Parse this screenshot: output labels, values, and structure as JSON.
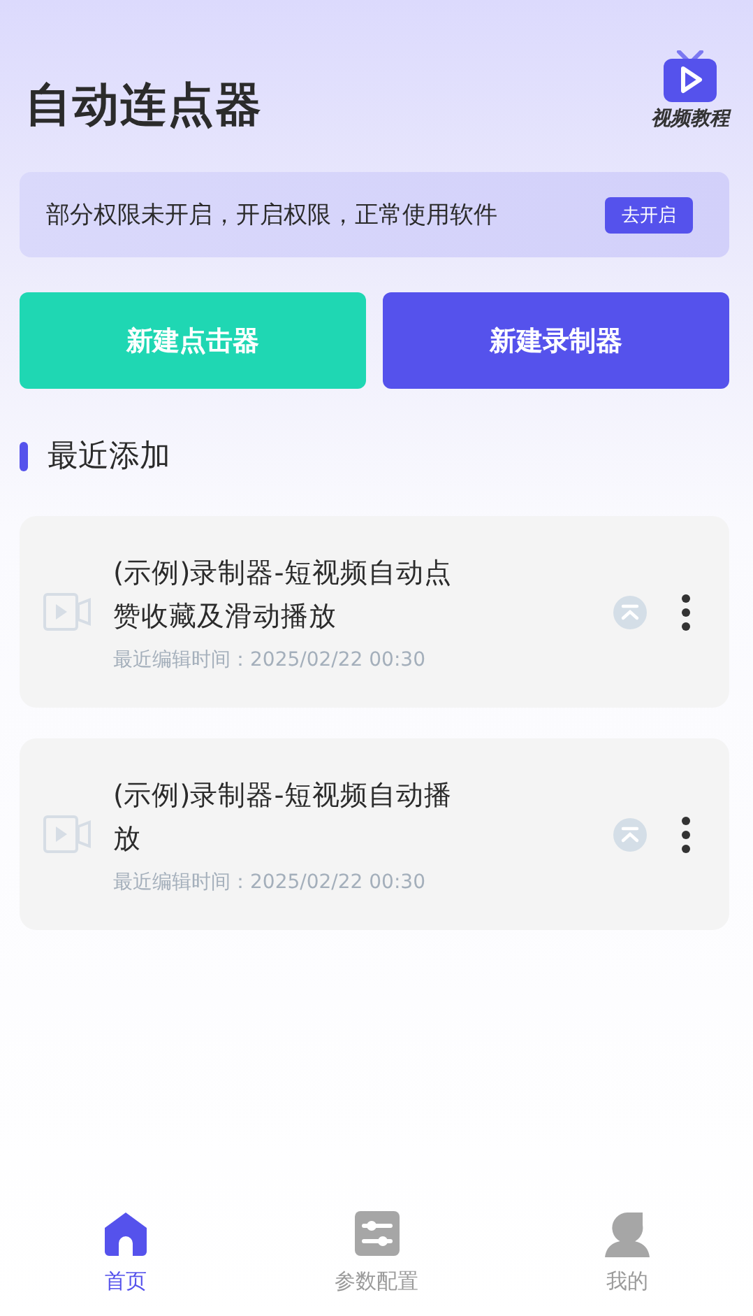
{
  "header": {
    "title": "自动连点器",
    "tutorial_label": "视频教程"
  },
  "permission_banner": {
    "message": "部分权限未开启，开启权限，正常使用软件",
    "action": "去开启"
  },
  "actions": [
    {
      "label": "新建点击器",
      "kind": "clicker"
    },
    {
      "label": "新建录制器",
      "kind": "recorder"
    }
  ],
  "section": {
    "title": "最近添加"
  },
  "items": [
    {
      "title": "(示例)录制器-短视频自动点赞收藏及滑动播放",
      "edited": "最近编辑时间：2025/02/22 00:30"
    },
    {
      "title": "(示例)录制器-短视频自动播放",
      "edited": "最近编辑时间：2025/02/22 00:30"
    }
  ],
  "tabs": [
    {
      "label": "首页",
      "kind": "home",
      "selected": true
    },
    {
      "label": "参数配置",
      "kind": "sliders",
      "selected": false
    },
    {
      "label": "我的",
      "kind": "user",
      "selected": false
    }
  ]
}
